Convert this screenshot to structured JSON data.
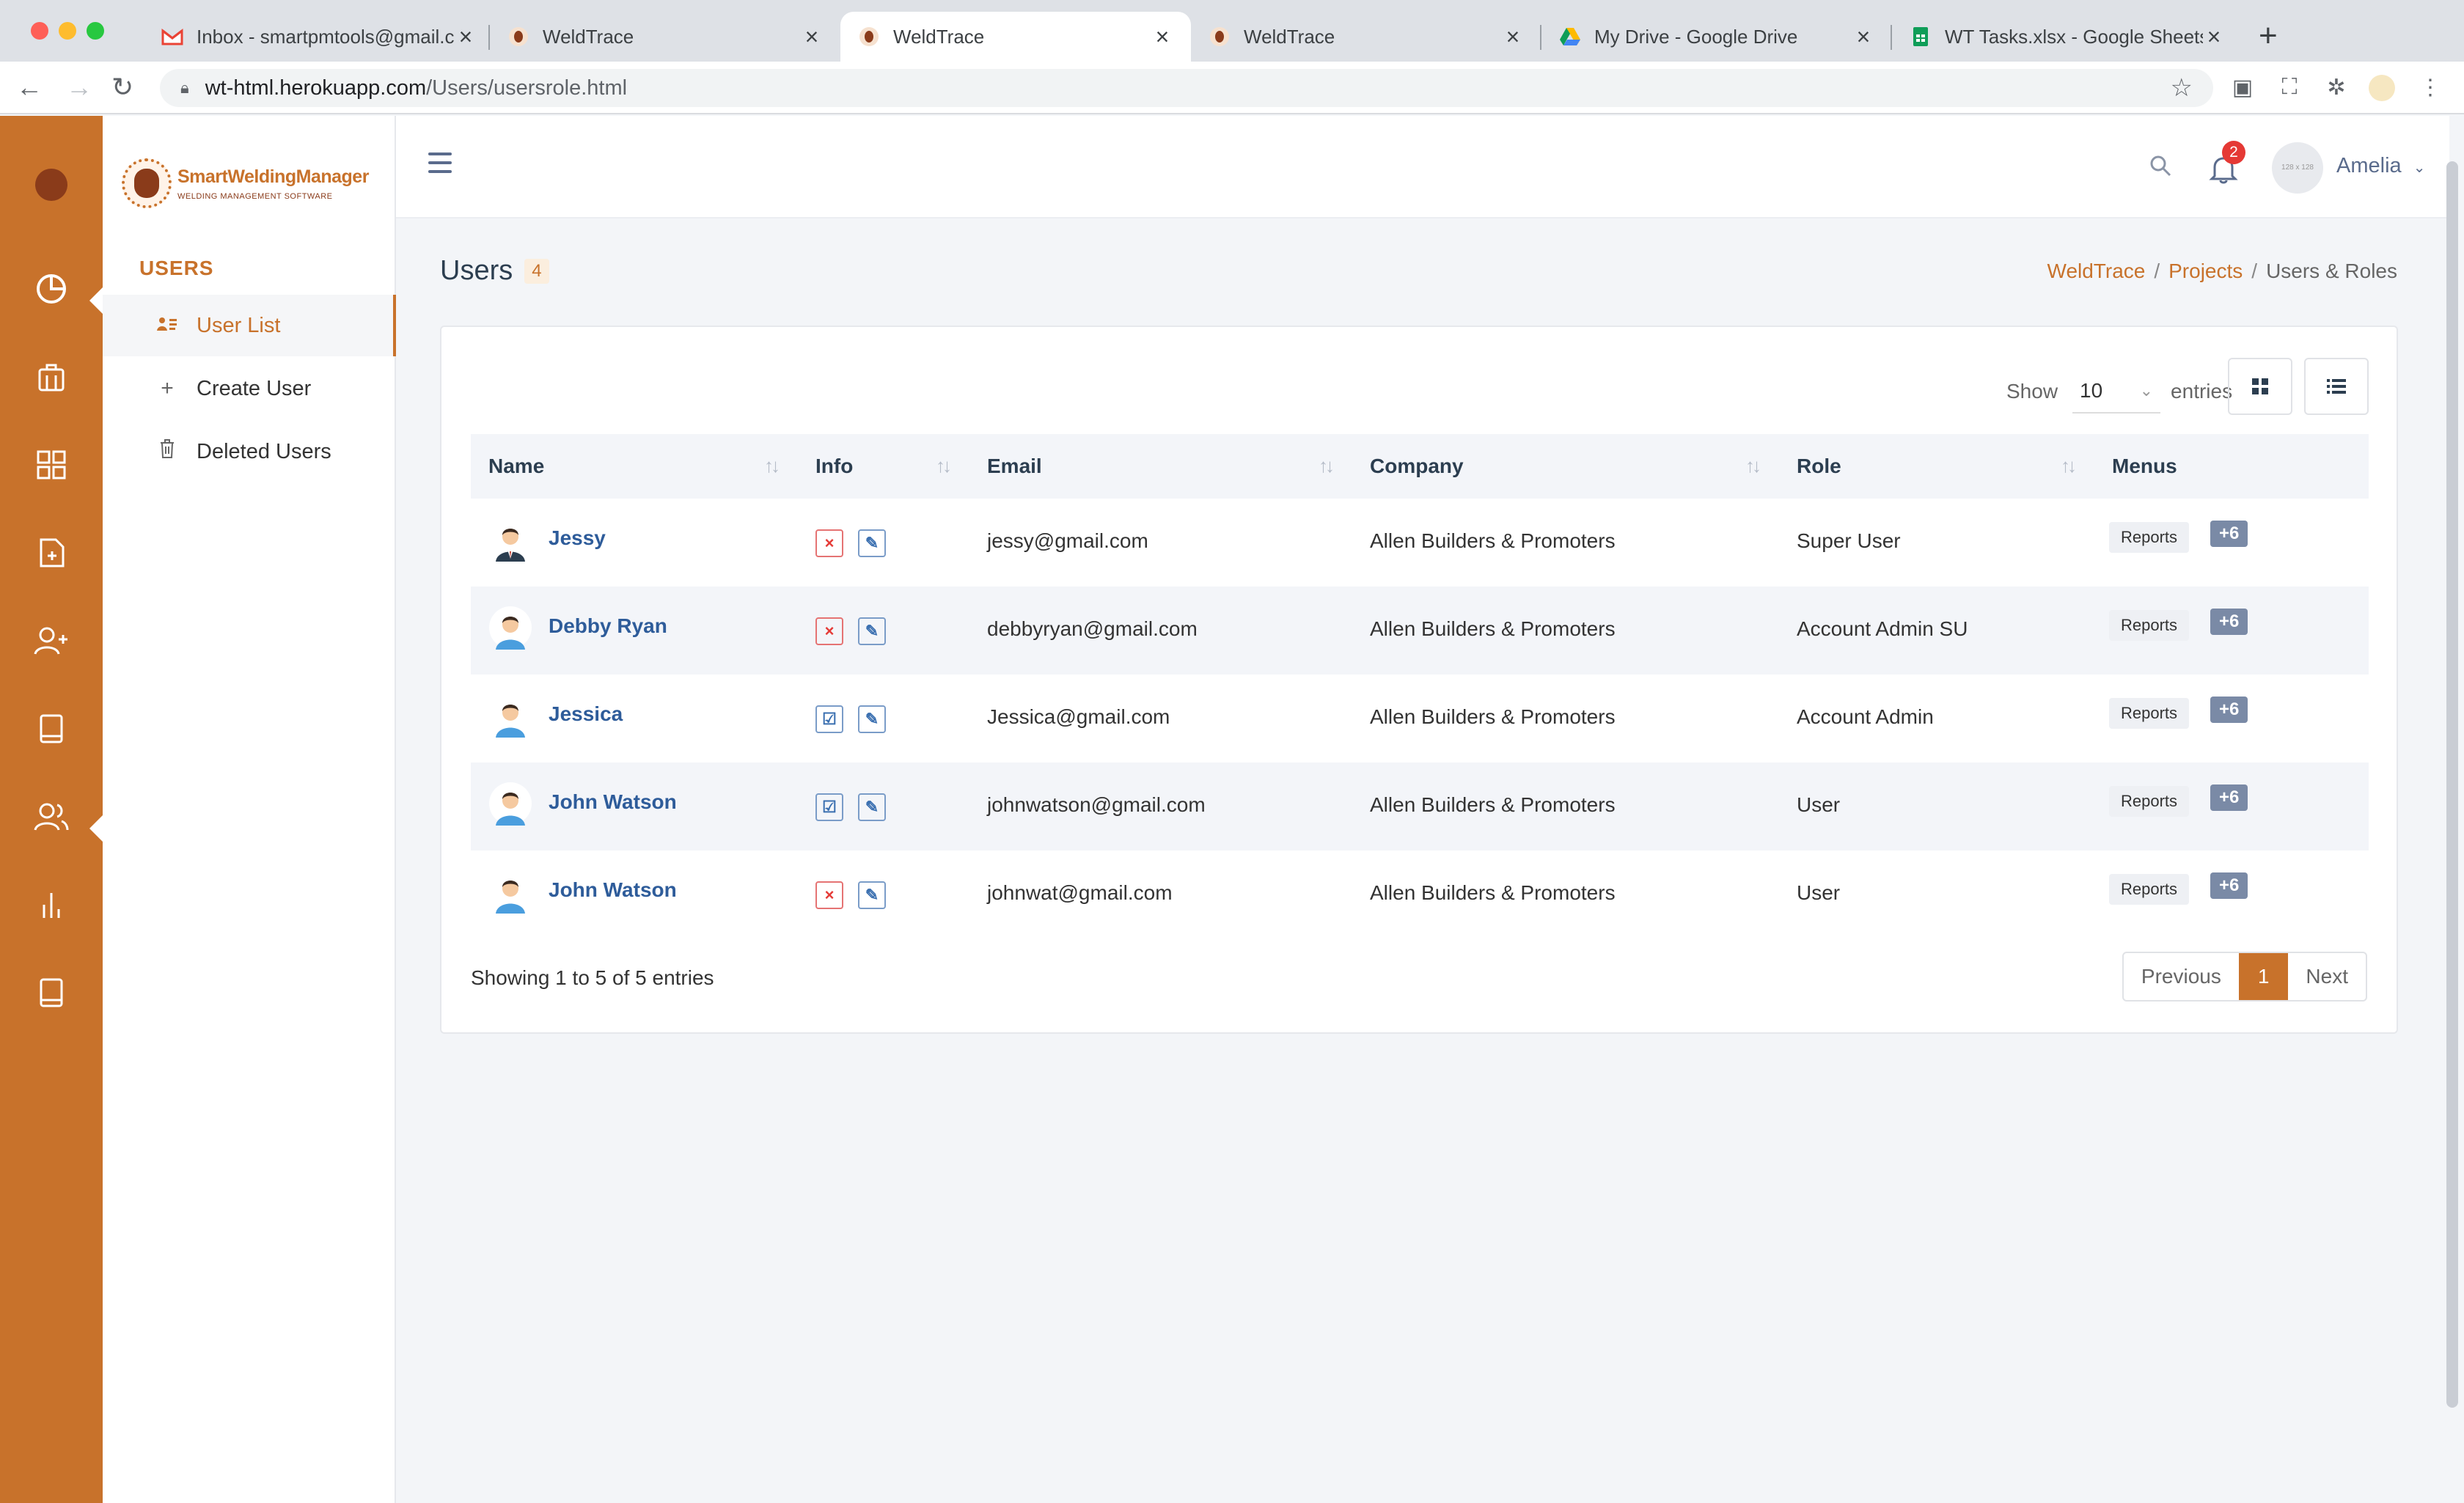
{
  "browser": {
    "tabs": [
      {
        "title": "Inbox - smartpmtools@gmail.c",
        "icon": "gmail-icon"
      },
      {
        "title": "WeldTrace",
        "icon": "weldtrace-icon"
      },
      {
        "title": "WeldTrace",
        "icon": "weldtrace-icon"
      },
      {
        "title": "WeldTrace",
        "icon": "weldtrace-icon"
      },
      {
        "title": "My Drive - Google Drive",
        "icon": "google-drive-icon"
      },
      {
        "title": "WT Tasks.xlsx - Google Sheets",
        "icon": "google-sheets-icon"
      }
    ],
    "active_tab": 2,
    "url_host": "wt-html.herokuapp.com",
    "url_path": "/Users/usersrole.html"
  },
  "brand": {
    "name": "SmartWeldingManager",
    "tagline": "WELDING MANAGEMENT SOFTWARE",
    "accent": "#c8722b"
  },
  "sidebar": {
    "section": "USERS",
    "items": [
      {
        "label": "User List",
        "icon": "user-list-icon",
        "active": true
      },
      {
        "label": "Create User",
        "icon": "plus-icon",
        "active": false
      },
      {
        "label": "Deleted Users",
        "icon": "trash-icon",
        "active": false
      }
    ]
  },
  "rail": {
    "icons": [
      "pie-chart-icon",
      "building-icon",
      "grid-icon",
      "file-plus-icon",
      "user-plus-icon",
      "book-icon",
      "users-icon",
      "bar-chart-icon",
      "book-icon"
    ],
    "active": "users-icon"
  },
  "header": {
    "notifications": "2",
    "avatar_placeholder": "128 x 128",
    "user": "Amelia"
  },
  "page": {
    "title": "Users",
    "count": "4",
    "breadcrumb": [
      "WeldTrace",
      "Projects",
      "Users & Roles"
    ]
  },
  "table": {
    "show_label": "Show",
    "entries_value": "10",
    "entries_label": "entries",
    "columns": [
      "Name",
      "Info",
      "Email",
      "Company",
      "Role",
      "Menus"
    ],
    "rows": [
      {
        "name": "Jessy",
        "info": "inactive",
        "email": "jessy@gmail.com",
        "company": "Allen Builders & Promoters",
        "role": "Super User",
        "menu": "Reports",
        "more": "+6"
      },
      {
        "name": "Debby Ryan",
        "info": "inactive",
        "email": "debbyryan@gmail.com",
        "company": "Allen Builders & Promoters",
        "role": "Account Admin SU",
        "menu": "Reports",
        "more": "+6"
      },
      {
        "name": "Jessica",
        "info": "active",
        "email": "Jessica@gmail.com",
        "company": "Allen Builders & Promoters",
        "role": "Account Admin",
        "menu": "Reports",
        "more": "+6"
      },
      {
        "name": "John Watson",
        "info": "active",
        "email": "johnwatson@gmail.com",
        "company": "Allen Builders & Promoters",
        "role": "User",
        "menu": "Reports",
        "more": "+6"
      },
      {
        "name": "John Watson",
        "info": "inactive",
        "email": "johnwat@gmail.com",
        "company": "Allen Builders & Promoters",
        "role": "User",
        "menu": "Reports",
        "more": "+6"
      }
    ],
    "footer": "Showing 1 to 5 of 5 entries",
    "pager": {
      "prev": "Previous",
      "current": "1",
      "next": "Next"
    }
  }
}
